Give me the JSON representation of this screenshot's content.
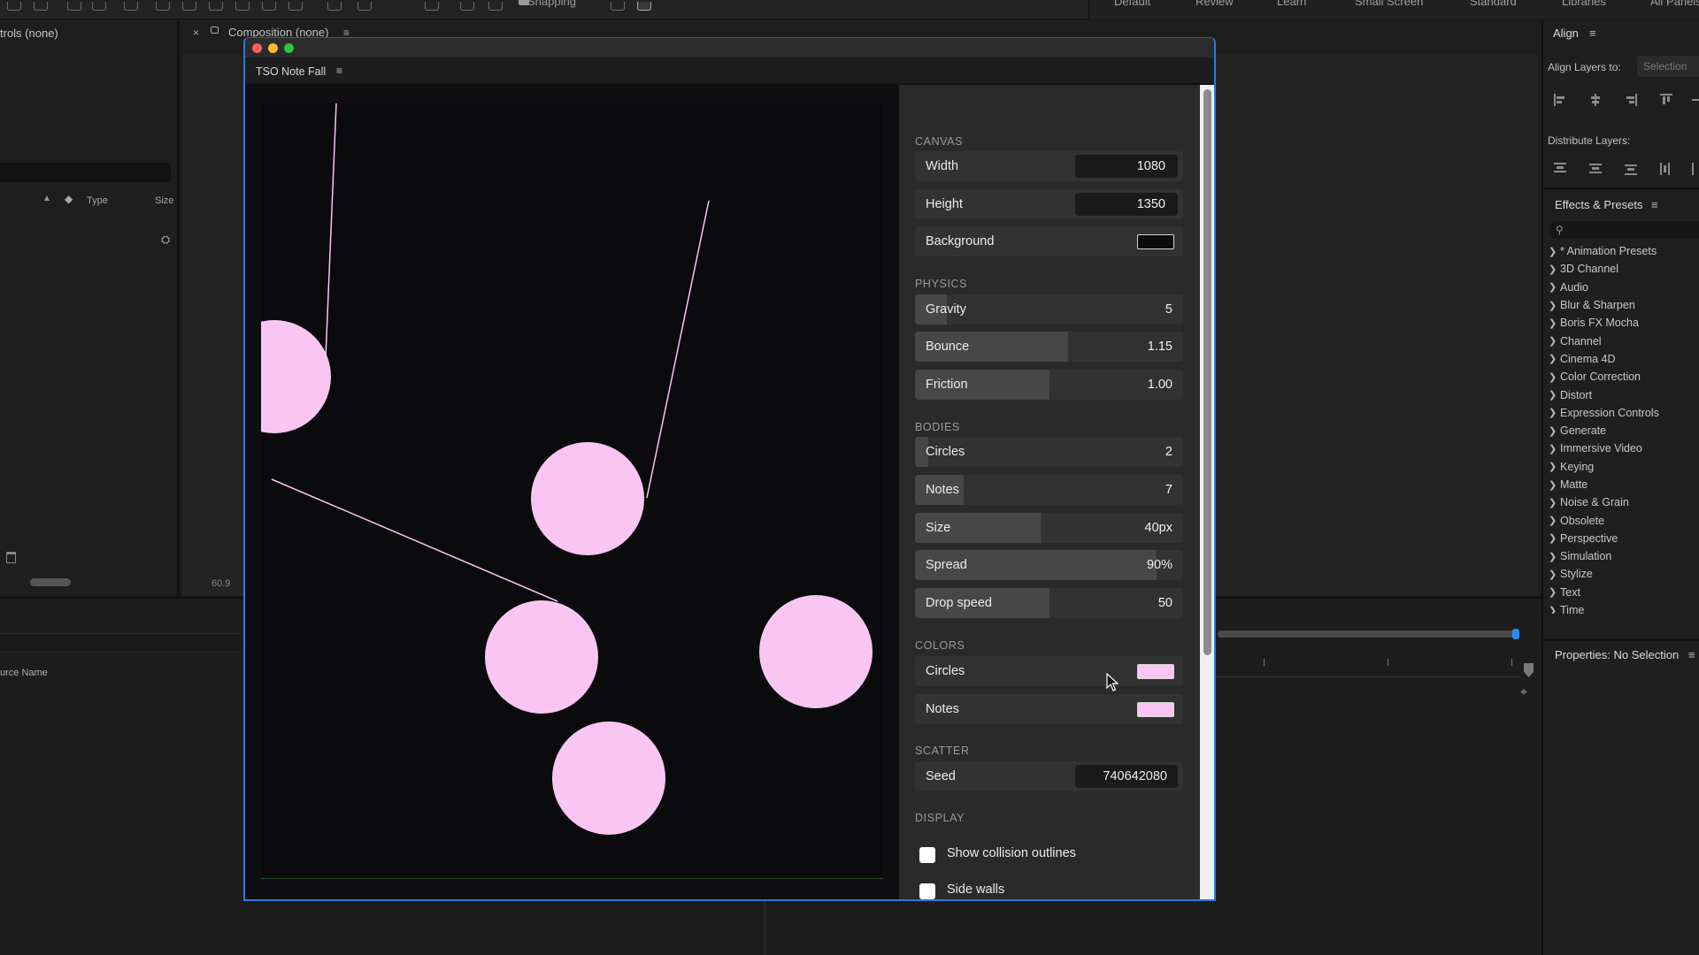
{
  "app": {
    "left_panel_title": "trols (none)",
    "left_columns": {
      "type": "Type",
      "size": "Size"
    },
    "comp_tab_label": "Composition (none)",
    "zoom": "60.9",
    "timeline_source_col": "urce Name",
    "toolbar_snapping": "Snapping",
    "workspaces": [
      "Default",
      "Review",
      "Learn",
      "Small Screen",
      "Standard",
      "Libraries",
      "All Panels"
    ]
  },
  "align": {
    "title": "Align",
    "align_layers_to": "Align Layers to:",
    "selection": "Selection",
    "distribute_layers": "Distribute Layers:"
  },
  "effects": {
    "title": "Effects & Presets",
    "items": [
      "* Animation Presets",
      "3D Channel",
      "Audio",
      "Blur & Sharpen",
      "Boris FX Mocha",
      "Channel",
      "Cinema 4D",
      "Color Correction",
      "Distort",
      "Expression Controls",
      "Generate",
      "Immersive Video",
      "Keying",
      "Matte",
      "Noise & Grain",
      "Obsolete",
      "Perspective",
      "Simulation",
      "Stylize",
      "Text",
      "Time"
    ]
  },
  "properties": {
    "title": "Properties: No Selection"
  },
  "plugin": {
    "title": "TSO Note Fall",
    "canvas": {
      "label": "CANVAS",
      "width_label": "Width",
      "width": "1080",
      "height_label": "Height",
      "height": "1350",
      "background_label": "Background",
      "background_color": "#0b0a0c"
    },
    "physics": {
      "label": "PHYSICS",
      "gravity_label": "Gravity",
      "gravity": "5",
      "gravity_level": 0.12,
      "bounce_label": "Bounce",
      "bounce": "1.15",
      "bounce_level": 0.57,
      "friction_label": "Friction",
      "friction": "1.00",
      "friction_level": 0.5
    },
    "bodies": {
      "label": "BODIES",
      "circles_label": "Circles",
      "circles": "2",
      "circles_level": 0.05,
      "notes_label": "Notes",
      "notes": "7",
      "notes_level": 0.18,
      "size_label": "Size",
      "size": "40px",
      "size_level": 0.47,
      "spread_label": "Spread",
      "spread": "90%",
      "spread_level": 0.9,
      "drop_label": "Drop speed",
      "drop": "50",
      "drop_level": 0.5
    },
    "colors": {
      "label": "COLORS",
      "circles_label": "Circles",
      "circles_color": "#f9c6f3",
      "notes_label": "Notes",
      "notes_color": "#f9c6f3"
    },
    "scatter": {
      "label": "SCATTER",
      "seed_label": "Seed",
      "seed": "740642080"
    },
    "display": {
      "label": "DISPLAY",
      "outlines_label": "Show collision outlines",
      "outlines_checked": false,
      "walls_label": "Side walls",
      "walls_checked": false
    }
  }
}
